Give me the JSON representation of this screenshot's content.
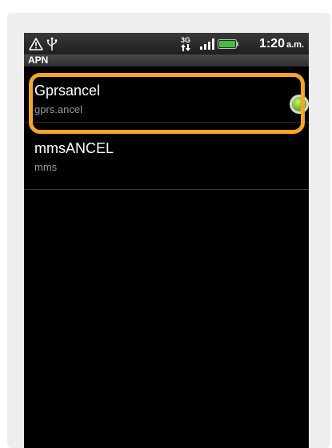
{
  "status_bar": {
    "icons": [
      "warning-icon",
      "usb-icon",
      "3g-data-icon",
      "signal-icon",
      "battery-icon"
    ],
    "network_label": "3G",
    "time": "1:20",
    "ampm": "a.m."
  },
  "section": {
    "title": "APN"
  },
  "apn_list": [
    {
      "name": "Gprsancel",
      "apn": "gprs.ancel",
      "selected": true
    },
    {
      "name": "mmsANCEL",
      "apn": "mms",
      "selected": false
    }
  ],
  "colors": {
    "highlight": "#f5a623",
    "radio_selected": "#76b82a",
    "background": "#000000"
  }
}
